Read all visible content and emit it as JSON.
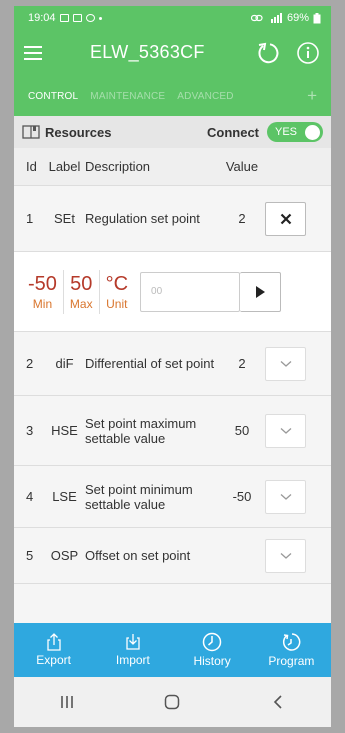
{
  "status": {
    "time": "19:04",
    "battery": "69%"
  },
  "app": {
    "title": "ELW_5363CF"
  },
  "tabs": [
    {
      "label": "CONTROL",
      "active": true
    },
    {
      "label": "MAINTENANCE",
      "active": false
    },
    {
      "label": "ADVANCED",
      "active": false
    }
  ],
  "tab_add": "+",
  "resources": {
    "title": "Resources",
    "connect_label": "Connect",
    "toggle_label": "YES"
  },
  "table": {
    "headers": {
      "id": "Id",
      "label": "Label",
      "description": "Description",
      "value": "Value"
    },
    "rows": [
      {
        "id": "1",
        "label": "SEt",
        "description": "Regulation set point",
        "value": "2"
      },
      {
        "id": "2",
        "label": "diF",
        "description": "Differential of set point",
        "value": "2"
      },
      {
        "id": "3",
        "label": "HSE",
        "description": "Set point maximum settable value",
        "value": "50"
      },
      {
        "id": "4",
        "label": "LSE",
        "description": "Set point minimum settable value",
        "value": "-50"
      },
      {
        "id": "5",
        "label": "OSP",
        "description": "Offset on set point",
        "value": ""
      }
    ]
  },
  "edit": {
    "min_value": "-50",
    "min_label": "Min",
    "max_value": "50",
    "max_label": "Max",
    "unit_value": "°C",
    "unit_label": "Unit",
    "input_placeholder": "00"
  },
  "bottom": [
    {
      "label": "Export",
      "icon": "export-icon"
    },
    {
      "label": "Import",
      "icon": "import-icon"
    },
    {
      "label": "History",
      "icon": "history-icon"
    },
    {
      "label": "Program",
      "icon": "program-icon"
    }
  ],
  "colors": {
    "primary": "#5cc466",
    "accent_bar": "#2fa8df",
    "min_max_value": "#b53a2a",
    "min_max_label": "#d9762e"
  }
}
